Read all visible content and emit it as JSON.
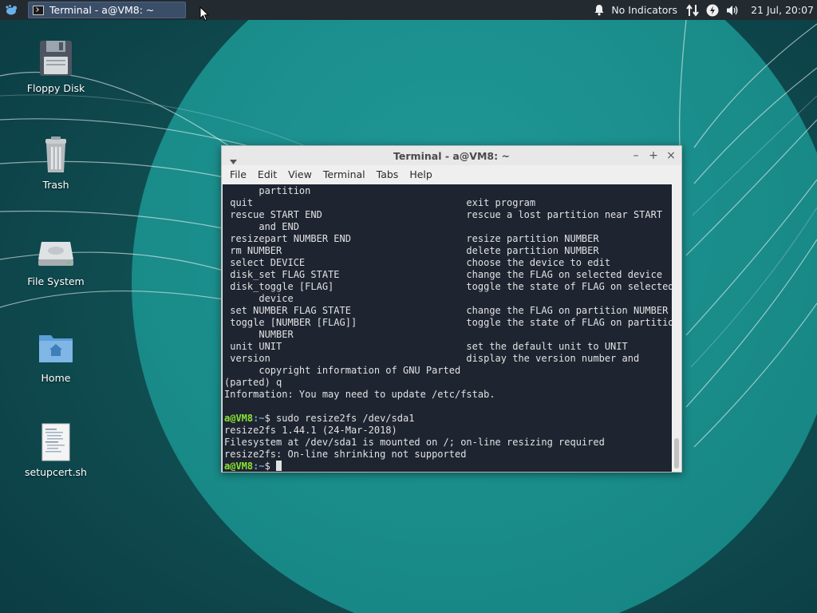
{
  "panel": {
    "task_label": "Terminal - a@VM8: ~",
    "notification_text": "No Indicators",
    "clock": "21 Jul, 20:07",
    "icons": [
      "xfce-mouse-icon",
      "bell-icon",
      "network-icon",
      "power-icon",
      "volume-icon"
    ]
  },
  "desktop": {
    "icons": [
      {
        "label": "Floppy Disk",
        "icon": "floppy-disk-icon"
      },
      {
        "label": "Trash",
        "icon": "trash-icon"
      },
      {
        "label": "File System",
        "icon": "hard-drive-icon"
      },
      {
        "label": "Home",
        "icon": "home-folder-icon"
      },
      {
        "label": "setupcert.sh",
        "icon": "script-file-icon"
      }
    ]
  },
  "window": {
    "title": "Terminal - a@VM8: ~",
    "menu": [
      "File",
      "Edit",
      "View",
      "Terminal",
      "Tabs",
      "Help"
    ],
    "controls": {
      "minimize": "–",
      "maximize": "+",
      "close": "×"
    }
  },
  "terminal": {
    "lines": [
      {
        "text": "      partition"
      },
      {
        "text": " quit                                     exit program"
      },
      {
        "text": " rescue START END                         rescue a lost partition near START"
      },
      {
        "text": "      and END"
      },
      {
        "text": " resizepart NUMBER END                    resize partition NUMBER"
      },
      {
        "text": " rm NUMBER                                delete partition NUMBER"
      },
      {
        "text": " select DEVICE                            choose the device to edit"
      },
      {
        "text": " disk_set FLAG STATE                      change the FLAG on selected device"
      },
      {
        "text": " disk_toggle [FLAG]                       toggle the state of FLAG on selected"
      },
      {
        "text": "      device"
      },
      {
        "text": " set NUMBER FLAG STATE                    change the FLAG on partition NUMBER"
      },
      {
        "text": " toggle [NUMBER [FLAG]]                   toggle the state of FLAG on partition"
      },
      {
        "text": "      NUMBER"
      },
      {
        "text": " unit UNIT                                set the default unit to UNIT"
      },
      {
        "text": " version                                  display the version number and"
      },
      {
        "text": "      copyright information of GNU Parted"
      },
      {
        "text": "(parted) q"
      },
      {
        "text": "Information: You may need to update /etc/fstab."
      },
      {
        "text": ""
      },
      {
        "user": "a@VM8",
        "path": ":~",
        "cmd": "$ sudo resize2fs /dev/sda1"
      },
      {
        "text": "resize2fs 1.44.1 (24-Mar-2018)"
      },
      {
        "text": "Filesystem at /dev/sda1 is mounted on /; on-line resizing required"
      },
      {
        "text": "resize2fs: On-line shrinking not supported"
      },
      {
        "user": "a@VM8",
        "path": ":~",
        "cmd": "$ ",
        "cursor": true
      }
    ]
  },
  "colors": {
    "panel_bg": "#232b30",
    "desktop_bg": "#0f4a4f",
    "circle": "#1a8c8b",
    "terminal_bg": "#1e2430",
    "prompt_user": "#8ae234",
    "prompt_path": "#729fcf"
  }
}
